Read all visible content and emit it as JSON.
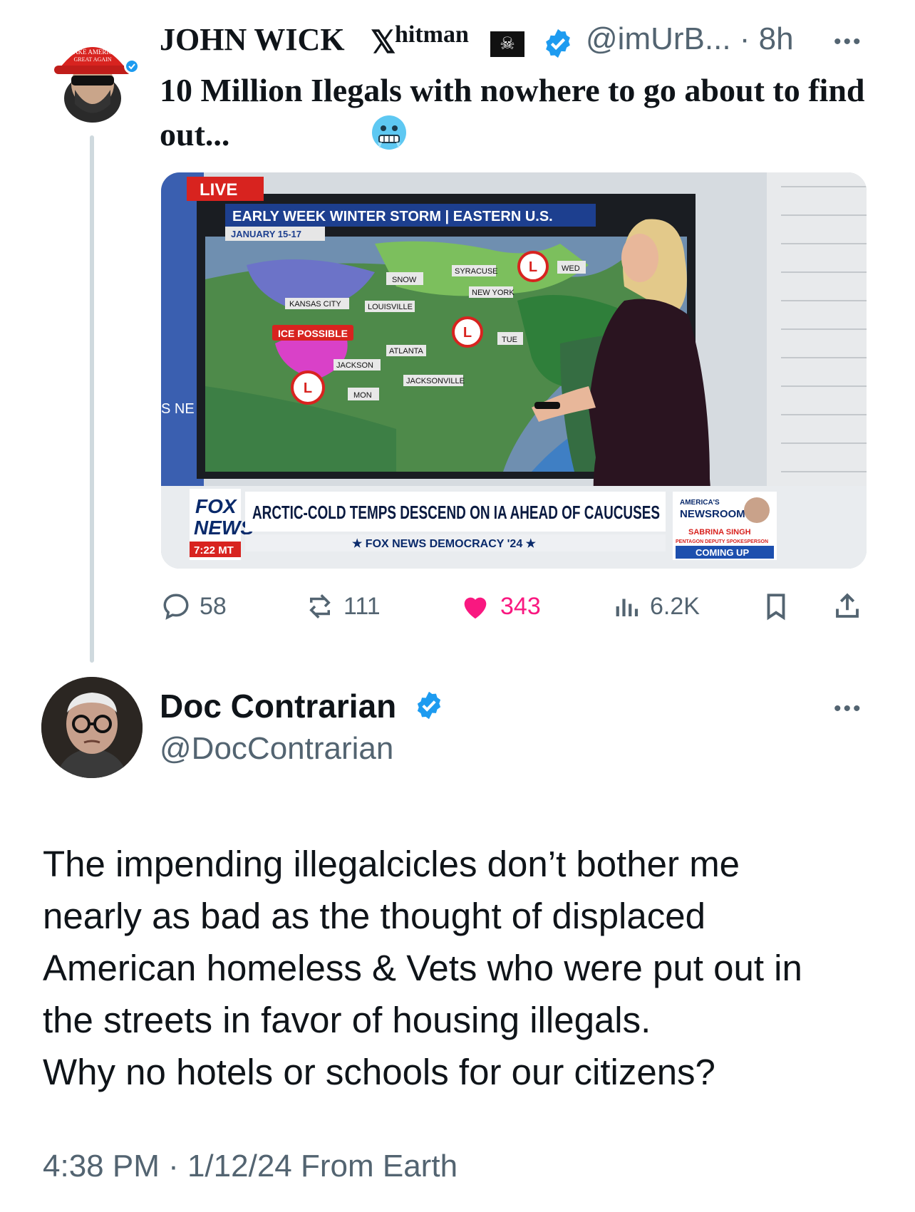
{
  "tweet1": {
    "name": "JOHN WICK",
    "x_glyph": "𝕏",
    "name_suffix": "hitman",
    "flag_emoji": "☠",
    "handle_time": "@imUrB... · 8h",
    "more": "•••",
    "text": "10 Million Ilegals with nowhere to go about to find out...",
    "emoji": "cold-face-icon",
    "media": {
      "live": "LIVE",
      "storm_title": "EARLY WEEK WINTER STORM | EASTERN U.S.",
      "storm_date": "JANUARY 15-17",
      "cities": {
        "kansas_city": "KANSAS CITY",
        "louisville": "LOUISVILLE",
        "snow": "SNOW",
        "syracuse": "SYRACUSE",
        "new_york": "NEW YORK",
        "atlanta": "ATLANTA",
        "jackson": "JACKSON",
        "jacksonville": "JACKSONVILLE",
        "ice_possible": "ICE POSSIBLE",
        "mon": "MON",
        "tue": "TUE",
        "wed": "WED",
        "low": "L",
        "ne": "S NE"
      },
      "fox": "FOX",
      "news": "NEWS",
      "time": "7:22 MT",
      "headline": "ARCTIC-COLD TEMPS DESCEND ON IA AHEAD OF CAUCUSES",
      "ticker": "★  FOX NEWS DEMOCRACY '24  ★",
      "show_top": "AMERICA'S",
      "show_name": "NEWSROOM",
      "guest_name": "SABRINA SINGH",
      "guest_title": "PENTAGON DEPUTY SPOKESPERSON",
      "coming_up": "COMING UP"
    },
    "actions": {
      "replies": "58",
      "reposts": "111",
      "likes": "343",
      "views": "6.2K"
    },
    "colors": {
      "like": "#f91880",
      "verified": "#1d9bf0",
      "muted": "#536471"
    }
  },
  "tweet2": {
    "name": "Doc Contrarian",
    "handle": "@DocContrarian",
    "more": "•••",
    "text": "The impending illegalcicles don’t bother me\nnearly as bad as the thought of displaced\nAmerican homeless & Vets who were put out in\nthe streets in favor of housing illegals.\nWhy no hotels or schools for our citizens?",
    "meta": "4:38 PM · 1/12/24 From Earth"
  }
}
